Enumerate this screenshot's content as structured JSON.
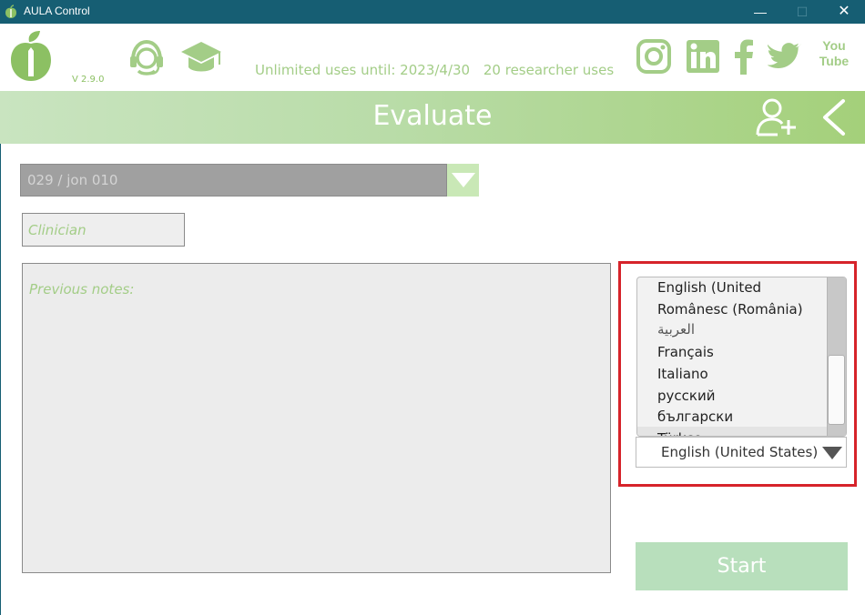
{
  "window": {
    "title": "AULA Control",
    "minimize_glyph": "—",
    "maximize_glyph": "☐",
    "close_glyph": "✕"
  },
  "header": {
    "version": "V 2.9.0",
    "license_until": "Unlimited uses until:  2023/4/30",
    "researcher_uses": "20 researcher uses",
    "icons": [
      "headset-icon",
      "graduation-cap-icon",
      "instagram-icon",
      "linkedin-icon",
      "facebook-icon",
      "twitter-icon",
      "youtube-icon"
    ],
    "youtube_label": "You Tube"
  },
  "banner": {
    "title": "Evaluate",
    "icons": [
      "add-user-icon",
      "back-chevron-icon"
    ]
  },
  "form": {
    "patient_value": "029 / jon 010",
    "clinician_placeholder": "Clinician",
    "notes_placeholder": "Previous notes:"
  },
  "language": {
    "options": [
      "English (United",
      "Românesc (România)",
      "العربية",
      "Français",
      "Italiano",
      "русский",
      "български",
      "Türkçe"
    ],
    "selected": "English (United States)"
  },
  "actions": {
    "start_label": "Start"
  },
  "colors": {
    "titlebar": "#165e73",
    "accent_green": "#a3cd87",
    "banner_start": "#c9e4c0",
    "banner_end": "#a4d07a",
    "highlight_red": "#d6232a",
    "start_button": "#b8dfbc"
  }
}
